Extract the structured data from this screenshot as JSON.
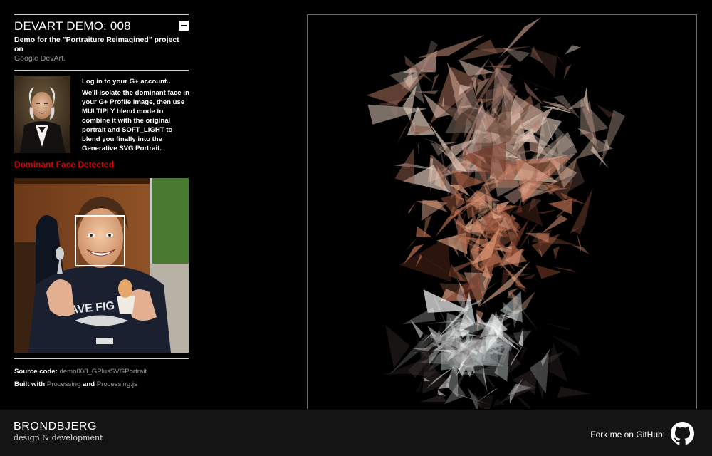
{
  "header": {
    "title": "DEVART DEMO: 008",
    "subtitle": "Demo for the \"Portraiture Reimagined\" project on",
    "subtitle_link": "Google DevArt."
  },
  "intro": {
    "paragraph1": "Log in to your G+ account..",
    "paragraph2": "We'll isolate the dominant face in your G+ Profile image, then use MULTIPLY blend mode to combine it with the original portrait and SOFT_LIGHT to blend you finally into the Generative SVG Portrait."
  },
  "detection": {
    "status": "Dominant Face Detected"
  },
  "links": {
    "source_label": "Source code:",
    "source_link": "demo008_GPlusSVGPortrait",
    "built_label": "Built with",
    "processing_link": "Processing",
    "and_text": "and",
    "processingjs_link": "Processing.js"
  },
  "footer": {
    "brand_name": "BRONDBJERG",
    "brand_tagline": "design & development",
    "fork_text": "Fork me on GitHub:"
  },
  "icons": {
    "collapse": "minus-icon",
    "github": "github-octocat-icon"
  },
  "colors": {
    "background": "#000000",
    "accent_red": "#e00000",
    "link_gray": "#9a9a9a",
    "footer_bg": "#141414"
  }
}
